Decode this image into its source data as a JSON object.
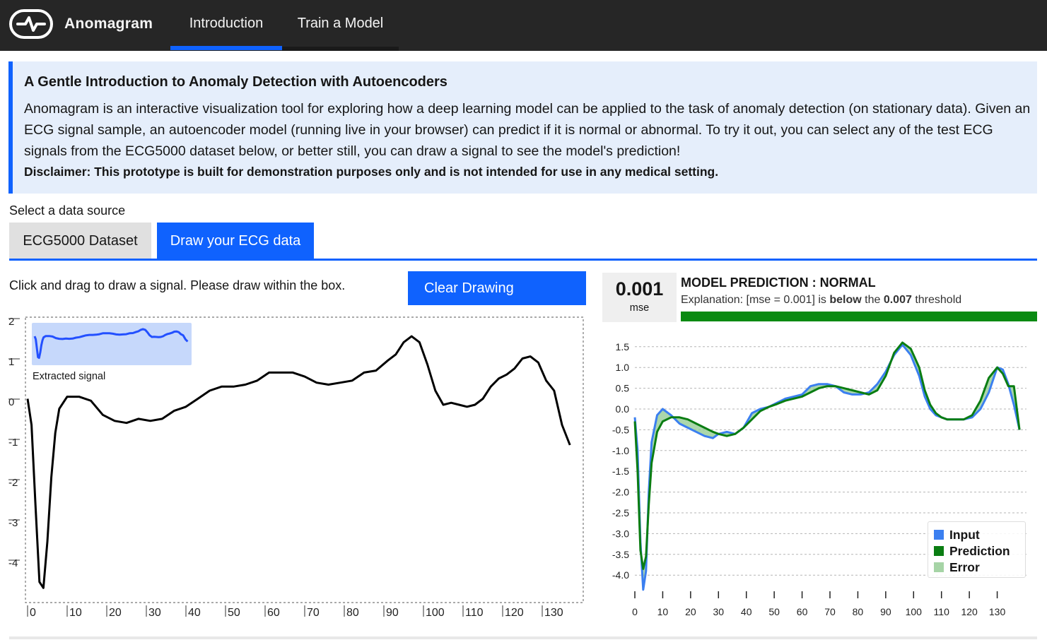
{
  "app": {
    "name": "Anomagram"
  },
  "nav": {
    "tabs": [
      {
        "label": "Introduction"
      },
      {
        "label": "Train a Model"
      }
    ]
  },
  "intro": {
    "title": "A Gentle Introduction to Anomaly Detection with Autoencoders",
    "body": "Anomagram is an interactive visualization tool for exploring how a deep learning model can be applied to the task of anomaly detection (on stationary data). Given an ECG signal sample, an autoencoder model (running live in your browser) can predict if it is normal or abnormal. To try it out, you can select any of the test ECG signals from the ECG5000 dataset below, or better still, you can draw a signal to see the model's prediction!",
    "disclaimer": "Disclaimer: This prototype is built for demonstration purposes only and is not intended for use in any medical setting."
  },
  "source": {
    "label": "Select a data source",
    "tabs": [
      {
        "label": "ECG5000 Dataset"
      },
      {
        "label": "Draw your ECG data"
      }
    ]
  },
  "draw": {
    "instruction": "Click and drag to draw a signal. Please draw within the box.",
    "clear_label": "Clear Drawing",
    "thumb_label": "Extracted signal",
    "y_ticks": [
      "2",
      "1",
      "0",
      "-1",
      "-2",
      "-3",
      "-4"
    ],
    "x_ticks": [
      "0",
      "10",
      "20",
      "30",
      "40",
      "50",
      "60",
      "70",
      "80",
      "90",
      "100",
      "110",
      "120",
      "130"
    ]
  },
  "prediction": {
    "mse_value": "0.001",
    "mse_label": "mse",
    "title": "MODEL PREDICTION :  NORMAL",
    "exp_pre": "Explanation: [mse = 0.001] is ",
    "exp_bold1": "below",
    "exp_mid": " the ",
    "exp_bold2": "0.007",
    "exp_post": " threshold",
    "bar_color": "#0a8a12"
  },
  "legend": {
    "input": "Input",
    "prediction": "Prediction",
    "error": "Error"
  },
  "colors": {
    "accent": "#0f62fe",
    "input": "#3b7ff0",
    "prediction": "#0a7d12",
    "error": "#8fc98f"
  },
  "chart_data": {
    "type": "line",
    "x_ticks": [
      0,
      10,
      20,
      30,
      40,
      50,
      60,
      70,
      80,
      90,
      100,
      110,
      120,
      130
    ],
    "y_ticks": [
      "1.5",
      "1.0",
      "0.5",
      "0.0",
      "-0.5",
      "-1.0",
      "-1.5",
      "-2.0",
      "-2.5",
      "-3.0",
      "-3.5",
      "-4.0"
    ],
    "ylim": [
      -4.5,
      1.75
    ],
    "xlim": [
      0,
      140
    ],
    "grid": true,
    "legend_position": "bottom-right",
    "series": [
      {
        "name": "Input",
        "x": [
          0,
          1,
          2,
          3,
          4,
          5,
          6,
          8,
          10,
          13,
          16,
          19,
          22,
          25,
          28,
          30,
          33,
          36,
          39,
          42,
          45,
          48,
          51,
          54,
          57,
          60,
          63,
          66,
          69,
          72,
          75,
          78,
          81,
          84,
          87,
          90,
          93,
          96,
          99,
          102,
          104,
          106,
          108,
          110,
          112,
          115,
          118,
          121,
          124,
          127,
          130,
          132,
          134,
          136,
          138
        ],
        "y": [
          -0.2,
          -1.0,
          -3.2,
          -4.35,
          -3.9,
          -2.0,
          -0.8,
          -0.15,
          0.0,
          -0.15,
          -0.35,
          -0.45,
          -0.55,
          -0.65,
          -0.7,
          -0.6,
          -0.55,
          -0.6,
          -0.45,
          -0.1,
          0.0,
          0.05,
          0.15,
          0.25,
          0.3,
          0.35,
          0.55,
          0.6,
          0.6,
          0.55,
          0.4,
          0.35,
          0.35,
          0.4,
          0.6,
          0.9,
          1.3,
          1.55,
          1.3,
          0.8,
          0.3,
          0.0,
          -0.15,
          -0.2,
          -0.25,
          -0.25,
          -0.25,
          -0.2,
          0.0,
          0.4,
          1.0,
          0.95,
          0.6,
          0.1,
          -0.5
        ]
      },
      {
        "name": "Prediction",
        "x": [
          0,
          1,
          2,
          3,
          4,
          5,
          6,
          8,
          10,
          13,
          16,
          19,
          22,
          25,
          28,
          30,
          33,
          36,
          39,
          42,
          45,
          48,
          51,
          54,
          57,
          60,
          63,
          66,
          69,
          72,
          75,
          78,
          81,
          84,
          87,
          90,
          93,
          96,
          99,
          102,
          104,
          106,
          108,
          110,
          112,
          115,
          118,
          121,
          124,
          127,
          130,
          132,
          134,
          136,
          138
        ],
        "y": [
          -0.3,
          -1.5,
          -3.4,
          -3.85,
          -3.55,
          -2.3,
          -1.3,
          -0.55,
          -0.3,
          -0.2,
          -0.2,
          -0.25,
          -0.35,
          -0.45,
          -0.55,
          -0.6,
          -0.65,
          -0.6,
          -0.45,
          -0.25,
          -0.05,
          0.05,
          0.12,
          0.2,
          0.25,
          0.3,
          0.4,
          0.5,
          0.55,
          0.55,
          0.5,
          0.45,
          0.4,
          0.35,
          0.45,
          0.8,
          1.35,
          1.6,
          1.45,
          1.0,
          0.45,
          0.1,
          -0.1,
          -0.2,
          -0.25,
          -0.25,
          -0.25,
          -0.15,
          0.2,
          0.75,
          1.0,
          0.85,
          0.55,
          0.55,
          -0.5
        ]
      }
    ]
  },
  "drawn_signal": {
    "x": [
      0,
      1,
      2,
      3,
      4,
      5,
      6,
      7,
      8,
      10,
      13,
      16,
      19,
      22,
      25,
      28,
      31,
      34,
      37,
      40,
      43,
      46,
      49,
      52,
      55,
      58,
      61,
      64,
      67,
      70,
      73,
      76,
      79,
      82,
      85,
      88,
      91,
      93,
      95,
      97,
      99,
      101,
      103,
      105,
      107,
      109,
      111,
      113,
      115,
      117,
      119,
      121,
      123,
      125,
      127,
      129,
      131,
      133,
      135,
      137
    ],
    "y": [
      0.15,
      -0.5,
      -2.5,
      -4.4,
      -4.55,
      -3.4,
      -1.8,
      -0.7,
      -0.1,
      0.2,
      0.2,
      0.1,
      -0.25,
      -0.4,
      -0.45,
      -0.35,
      -0.4,
      -0.35,
      -0.15,
      -0.05,
      0.15,
      0.35,
      0.45,
      0.45,
      0.5,
      0.6,
      0.8,
      0.8,
      0.8,
      0.7,
      0.55,
      0.5,
      0.55,
      0.6,
      0.8,
      0.85,
      1.1,
      1.25,
      1.55,
      1.7,
      1.55,
      1.0,
      0.35,
      0.0,
      0.05,
      0.0,
      -0.05,
      0.0,
      0.15,
      0.45,
      0.65,
      0.75,
      0.9,
      1.15,
      1.2,
      1.05,
      0.6,
      0.35,
      -0.5,
      -1.0
    ]
  }
}
